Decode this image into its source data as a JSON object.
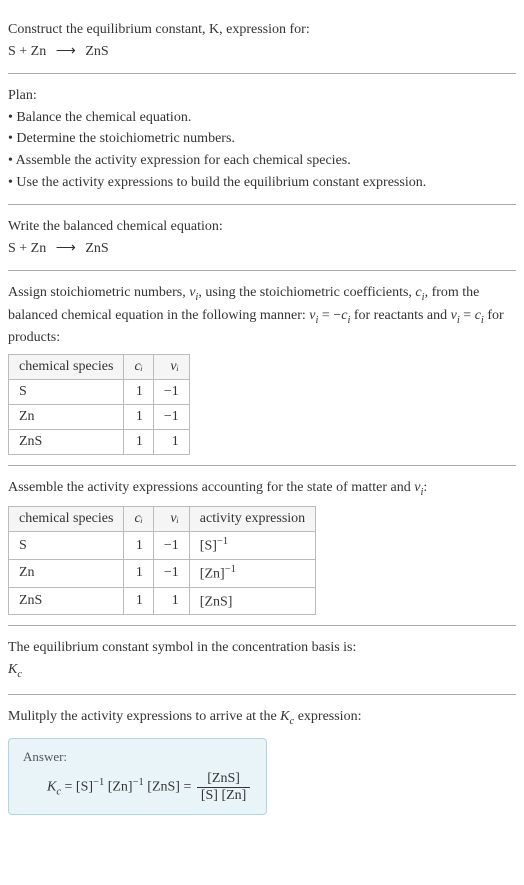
{
  "intro": {
    "prompt": "Construct the equilibrium constant, K, expression for:",
    "equation_lhs": "S + Zn",
    "equation_arrow": "⟶",
    "equation_rhs": "ZnS"
  },
  "plan": {
    "heading": "Plan:",
    "bullets": [
      "• Balance the chemical equation.",
      "• Determine the stoichiometric numbers.",
      "• Assemble the activity expression for each chemical species.",
      "• Use the activity expressions to build the equilibrium constant expression."
    ]
  },
  "balanced": {
    "heading": "Write the balanced chemical equation:",
    "equation_lhs": "S + Zn",
    "equation_arrow": "⟶",
    "equation_rhs": "ZnS"
  },
  "stoich": {
    "heading_part1": "Assign stoichiometric numbers, ",
    "nu_i": "ν",
    "heading_part2": ", using the stoichiometric coefficients, ",
    "c_i": "c",
    "heading_part3": ", from the balanced chemical equation in the following manner: ",
    "rel1_lhs": "ν",
    "rel1_eq": " = −",
    "rel1_rhs": "c",
    "rel_mid": " for reactants and ",
    "rel2_lhs": "ν",
    "rel2_eq": " = ",
    "rel2_rhs": "c",
    "rel_end": " for products:",
    "table": {
      "headers": {
        "species": "chemical species",
        "ci": "cᵢ",
        "nui": "νᵢ"
      },
      "rows": [
        {
          "species": "S",
          "ci": "1",
          "nui": "−1"
        },
        {
          "species": "Zn",
          "ci": "1",
          "nui": "−1"
        },
        {
          "species": "ZnS",
          "ci": "1",
          "nui": "1"
        }
      ]
    }
  },
  "activity": {
    "heading_part1": "Assemble the activity expressions accounting for the state of matter and ",
    "nu_i": "ν",
    "heading_part2": ":",
    "table": {
      "headers": {
        "species": "chemical species",
        "ci": "cᵢ",
        "nui": "νᵢ",
        "expr": "activity expression"
      },
      "rows": [
        {
          "species": "S",
          "ci": "1",
          "nui": "−1",
          "base": "[S]",
          "exp": "−1"
        },
        {
          "species": "Zn",
          "ci": "1",
          "nui": "−1",
          "base": "[Zn]",
          "exp": "−1"
        },
        {
          "species": "ZnS",
          "ci": "1",
          "nui": "1",
          "base": "[ZnS]",
          "exp": ""
        }
      ]
    }
  },
  "symbol": {
    "heading": "The equilibrium constant symbol in the concentration basis is:",
    "K": "K",
    "Ksub": "c"
  },
  "multiply": {
    "heading_part1": "Mulitply the activity expressions to arrive at the ",
    "K": "K",
    "Ksub": "c",
    "heading_part2": " expression:"
  },
  "answer": {
    "label": "Answer:",
    "K": "K",
    "Ksub": "c",
    "eq": " = ",
    "t1_base": "[S]",
    "t1_exp": "−1",
    "t2_base": "[Zn]",
    "t2_exp": "−1",
    "t3_base": "[ZnS]",
    "eq2": " = ",
    "frac_top": "[ZnS]",
    "frac_bot": "[S] [Zn]"
  },
  "chart_data": {
    "type": "table",
    "tables": [
      {
        "title": "Stoichiometric numbers",
        "columns": [
          "chemical species",
          "cᵢ",
          "νᵢ"
        ],
        "rows": [
          [
            "S",
            1,
            -1
          ],
          [
            "Zn",
            1,
            -1
          ],
          [
            "ZnS",
            1,
            1
          ]
        ]
      },
      {
        "title": "Activity expressions",
        "columns": [
          "chemical species",
          "cᵢ",
          "νᵢ",
          "activity expression"
        ],
        "rows": [
          [
            "S",
            1,
            -1,
            "[S]^-1"
          ],
          [
            "Zn",
            1,
            -1,
            "[Zn]^-1"
          ],
          [
            "ZnS",
            1,
            1,
            "[ZnS]"
          ]
        ]
      }
    ]
  }
}
